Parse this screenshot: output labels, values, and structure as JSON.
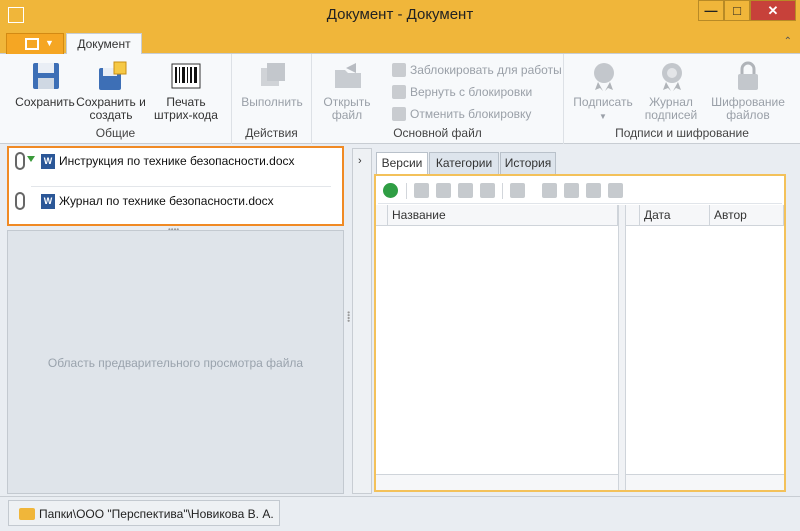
{
  "window": {
    "title": "Документ - Документ",
    "minimize_glyph": "—",
    "maximize_glyph": "□",
    "close_glyph": "✕"
  },
  "ribbon": {
    "tab": "Документ",
    "collapse_glyph": "⌃",
    "groups": {
      "general": {
        "label": "Общие",
        "save": "Сохранить",
        "save_create": "Сохранить и создать",
        "print_barcode": "Печать штрих-кода"
      },
      "actions": {
        "label": "Действия",
        "execute": "Выполнить"
      },
      "main_file": {
        "label": "Основной файл",
        "open_file": "Открыть файл",
        "lock": "Заблокировать для работы",
        "return_lock": "Вернуть с блокировки",
        "cancel_lock": "Отменить блокировку"
      },
      "signatures": {
        "label": "Подписи и шифрование",
        "sign": "Подписать",
        "sign_log": "Журнал подписей",
        "encrypt": "Шифрование файлов"
      }
    }
  },
  "files": [
    {
      "name": "Инструкция по технике безопасности.docx",
      "icon": "W"
    },
    {
      "name": "Журнал по технике безопасности.docx",
      "icon": "W"
    }
  ],
  "preview": {
    "placeholder": "Область предварительного просмотра файла"
  },
  "right_panel": {
    "tabs": [
      "Версии",
      "Категории",
      "История"
    ],
    "active_tab": "Версии",
    "columns": [
      "Название",
      "Дата",
      "Автор"
    ]
  },
  "status": {
    "path": "Папки\\ООО \"Перспектива\"\\Новикова В. А."
  }
}
